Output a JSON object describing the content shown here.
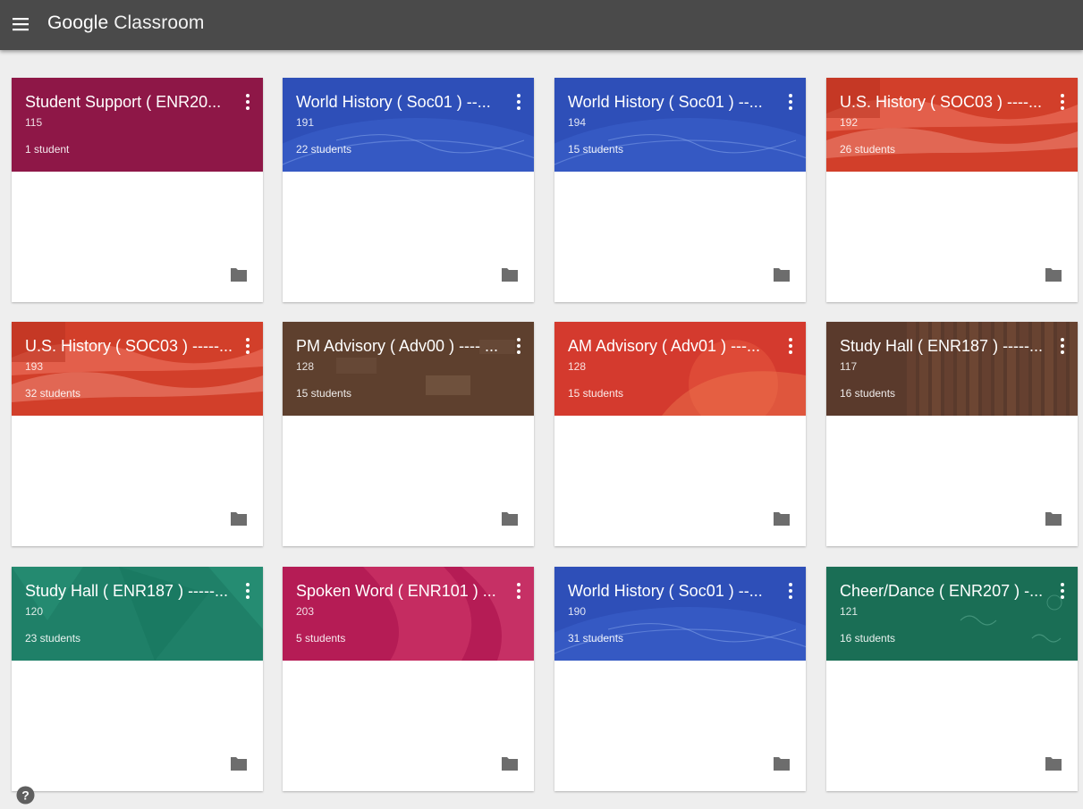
{
  "header": {
    "brand_google": "Google",
    "brand_app": "Classroom",
    "bar_color": "#4a4a4a"
  },
  "classes": [
    {
      "title": "Student Support ( ENR20...",
      "section": "115",
      "students": "1 student",
      "theme": "#8e1747",
      "art": "plain"
    },
    {
      "title": "World History ( Soc01 ) --...",
      "section": "191",
      "students": "22 students",
      "theme": "#2e4fb8",
      "art": "globe"
    },
    {
      "title": "World History ( Soc01 ) --...",
      "section": "194",
      "students": "15 students",
      "theme": "#2e4fb8",
      "art": "globe"
    },
    {
      "title": "U.S. History ( SOC03 ) ----...",
      "section": "192",
      "students": "26 students",
      "theme": "#d23f2a",
      "art": "flag"
    },
    {
      "title": "U.S. History ( SOC03 ) -----...",
      "section": "193",
      "students": "32 students",
      "theme": "#d23f2a",
      "art": "flag"
    },
    {
      "title": "PM Advisory ( Adv00 ) ---- ...",
      "section": "128",
      "students": "15 students",
      "theme": "#6a4a36",
      "art": "desks"
    },
    {
      "title": "AM Advisory ( Adv01 ) ---...",
      "section": "128",
      "students": "15 students",
      "theme": "#d43a2e",
      "art": "paint"
    },
    {
      "title": "Study Hall ( ENR187 ) -----...",
      "section": "117",
      "students": "16 students",
      "theme": "#5a3a2c",
      "art": "books"
    },
    {
      "title": "Study Hall ( ENR187 ) -----...",
      "section": "120",
      "students": "23 students",
      "theme": "#1f8068",
      "art": "poly"
    },
    {
      "title": "Spoken Word ( ENR101 ) ...",
      "section": "203",
      "students": "5 students",
      "theme": "#b51c55",
      "art": "fabric"
    },
    {
      "title": "World History ( Soc01 ) --...",
      "section": "190",
      "students": "31 students",
      "theme": "#2e4fb8",
      "art": "globe"
    },
    {
      "title": "Cheer/Dance ( ENR207 ) -...",
      "section": "121",
      "students": "16 students",
      "theme": "#1a6e55",
      "art": "chalk"
    }
  ],
  "icons": {
    "menu": "hamburger-menu-icon",
    "kebab": "more-vert-icon",
    "folder": "folder-icon",
    "help": "help-icon"
  },
  "colors": {
    "background": "#eeeeee",
    "folder_icon": "#6d6d6d"
  }
}
